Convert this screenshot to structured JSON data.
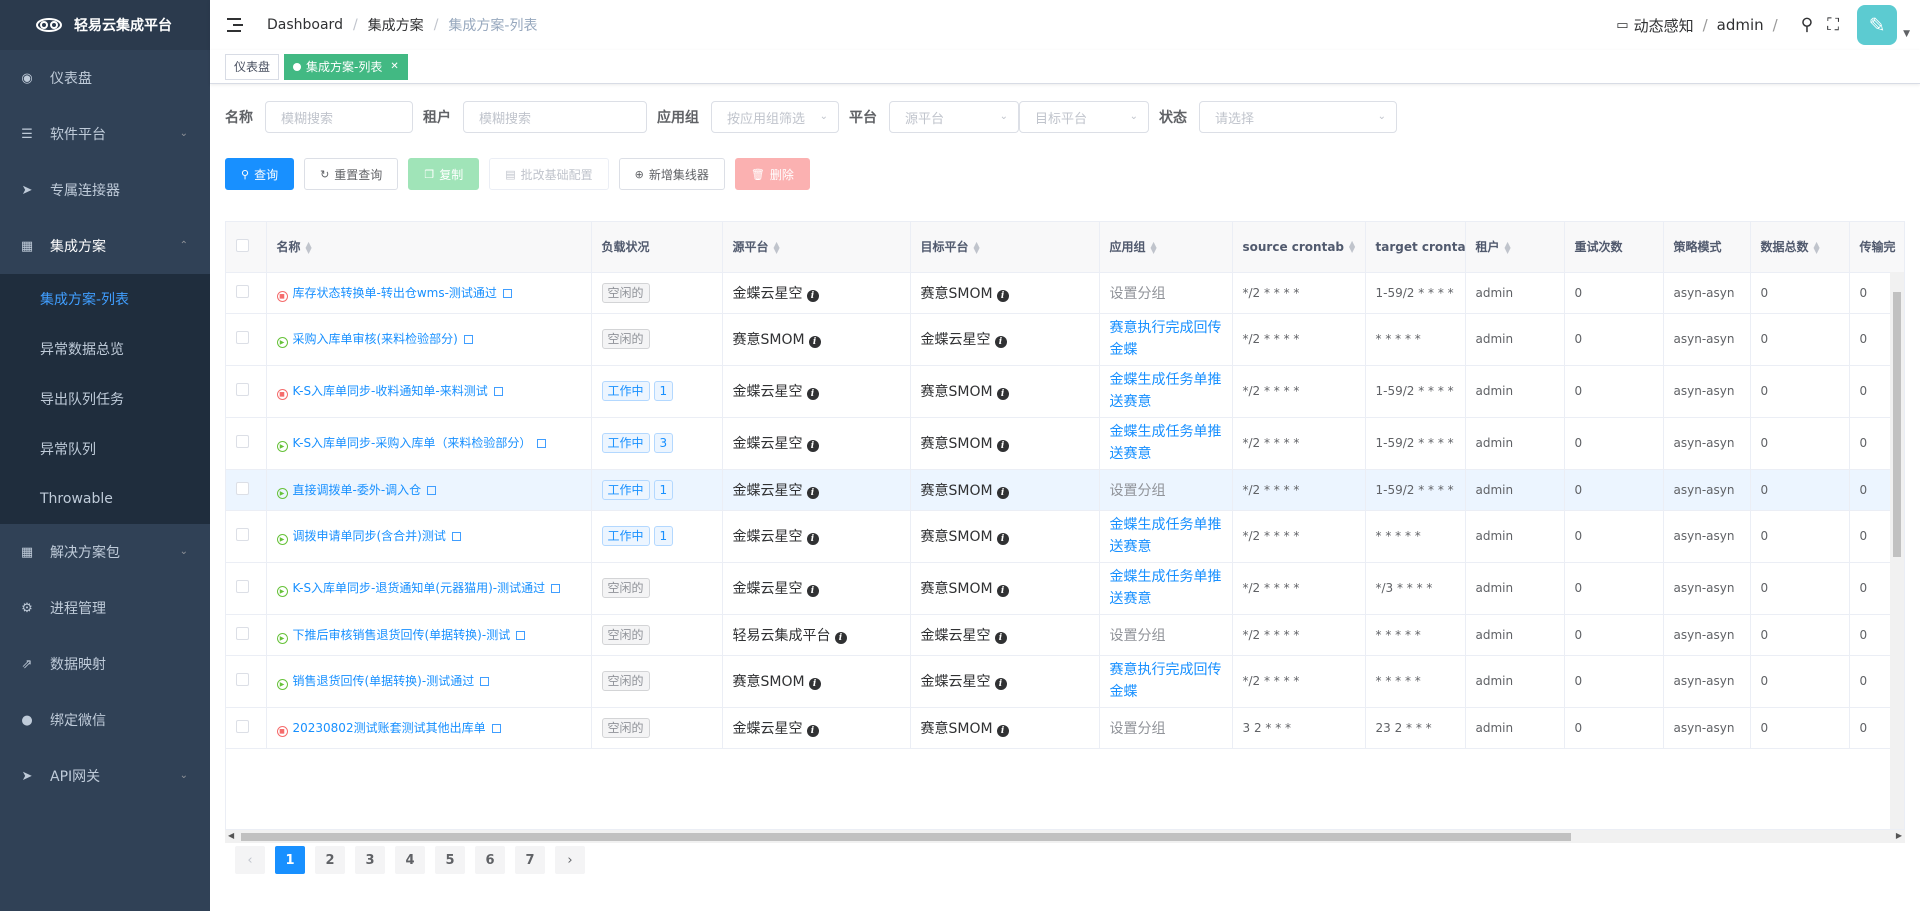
{
  "app": {
    "title": "轻易云集成平台"
  },
  "sidebar": {
    "items": [
      {
        "label": "仪表盘",
        "icon": "dashboard-icon"
      },
      {
        "label": "软件平台",
        "icon": "database-icon"
      },
      {
        "label": "专属连接器",
        "icon": "send-icon"
      },
      {
        "label": "集成方案",
        "icon": "grid-icon"
      },
      {
        "label": "解决方案包",
        "icon": "grid-icon"
      },
      {
        "label": "进程管理",
        "icon": "chip-icon"
      },
      {
        "label": "数据映射",
        "icon": "external-link-icon"
      },
      {
        "label": "绑定微信",
        "icon": "wechat-icon"
      },
      {
        "label": "API网关",
        "icon": "send-icon"
      }
    ],
    "sub_items": [
      "集成方案-列表",
      "异常数据总览",
      "导出队列任务",
      "异常队列",
      "Throwable"
    ]
  },
  "header": {
    "breadcrumb": [
      "Dashboard",
      "集成方案",
      "集成方案-列表"
    ],
    "dynamic": "动态感知",
    "user": "admin"
  },
  "tags": {
    "dashboard": "仪表盘",
    "current": "集成方案-列表"
  },
  "filters": {
    "name_label": "名称",
    "name_placeholder": "模糊搜索",
    "tenant_label": "租户",
    "tenant_placeholder": "模糊搜索",
    "group_label": "应用组",
    "group_placeholder": "按应用组筛选",
    "platform_label": "平台",
    "source_placeholder": "源平台",
    "target_placeholder": "目标平台",
    "status_label": "状态",
    "status_placeholder": "请选择"
  },
  "toolbar": {
    "query": "查询",
    "reset": "重置查询",
    "copy": "复制",
    "batch": "批改基础配置",
    "add": "新增集线器",
    "delete": "删除"
  },
  "table": {
    "columns": [
      "名称",
      "负载状况",
      "源平台",
      "目标平台",
      "应用组",
      "source crontab",
      "target crontab",
      "租户",
      "重试次数",
      "策略模式",
      "数据总数",
      "传输完"
    ],
    "rows": [
      {
        "status": "err",
        "name": "库存状态转换单-转出仓wms-测试通过",
        "load": "空闲的",
        "count": "",
        "src": "金蝶云星空",
        "tgt": "赛意SMOM",
        "group": "设置分组",
        "glink": false,
        "sc": "*/2 * * * *",
        "tc": "1-59/2 * * * *",
        "tenant": "admin",
        "retry": "0",
        "mode": "asyn-asyn",
        "total": "0",
        "trans": "0"
      },
      {
        "status": "ok",
        "name": "采购入库单审核(来料检验部分)",
        "load": "空闲的",
        "count": "",
        "src": "赛意SMOM",
        "tgt": "金蝶云星空",
        "group": "赛意执行完成回传金蝶",
        "glink": true,
        "sc": "*/2 * * * *",
        "tc": "* * * * *",
        "tenant": "admin",
        "retry": "0",
        "mode": "asyn-asyn",
        "total": "0",
        "trans": "0"
      },
      {
        "status": "err",
        "name": "K-S入库单同步-收料通知单-来料测试",
        "load": "工作中",
        "count": "1",
        "src": "金蝶云星空",
        "tgt": "赛意SMOM",
        "group": "金蝶生成任务单推送赛意",
        "glink": true,
        "sc": "*/2 * * * *",
        "tc": "1-59/2 * * * *",
        "tenant": "admin",
        "retry": "0",
        "mode": "asyn-asyn",
        "total": "0",
        "trans": "0"
      },
      {
        "status": "ok",
        "name": "K-S入库单同步-采购入库单（来料检验部分）",
        "load": "工作中",
        "count": "3",
        "src": "金蝶云星空",
        "tgt": "赛意SMOM",
        "group": "金蝶生成任务单推送赛意",
        "glink": true,
        "sc": "*/2 * * * *",
        "tc": "1-59/2 * * * *",
        "tenant": "admin",
        "retry": "0",
        "mode": "asyn-asyn",
        "total": "0",
        "trans": "0"
      },
      {
        "status": "ok",
        "name": "直接调拨单-委外-调入仓",
        "load": "工作中",
        "count": "1",
        "src": "金蝶云星空",
        "tgt": "赛意SMOM",
        "group": "设置分组",
        "glink": false,
        "sc": "*/2 * * * *",
        "tc": "1-59/2 * * * *",
        "tenant": "admin",
        "retry": "0",
        "mode": "asyn-asyn",
        "total": "0",
        "trans": "0"
      },
      {
        "status": "ok",
        "name": "调拨申请单同步(含合并)测试",
        "load": "工作中",
        "count": "1",
        "src": "金蝶云星空",
        "tgt": "赛意SMOM",
        "group": "金蝶生成任务单推送赛意",
        "glink": true,
        "sc": "*/2 * * * *",
        "tc": "* * * * *",
        "tenant": "admin",
        "retry": "0",
        "mode": "asyn-asyn",
        "total": "0",
        "trans": "0"
      },
      {
        "status": "ok",
        "name": "K-S入库单同步-退货通知单(元器猫用)-测试通过",
        "load": "空闲的",
        "count": "",
        "src": "金蝶云星空",
        "tgt": "赛意SMOM",
        "group": "金蝶生成任务单推送赛意",
        "glink": true,
        "sc": "*/2 * * * *",
        "tc": "*/3 * * * *",
        "tenant": "admin",
        "retry": "0",
        "mode": "asyn-asyn",
        "total": "0",
        "trans": "0"
      },
      {
        "status": "ok",
        "name": "下推后审核销售退货回传(单据转换)-测试",
        "load": "空闲的",
        "count": "",
        "src": "轻易云集成平台",
        "tgt": "金蝶云星空",
        "group": "设置分组",
        "glink": false,
        "sc": "*/2 * * * *",
        "tc": "* * * * *",
        "tenant": "admin",
        "retry": "0",
        "mode": "asyn-asyn",
        "total": "0",
        "trans": "0"
      },
      {
        "status": "ok",
        "name": "销售退货回传(单据转换)-测试通过",
        "load": "空闲的",
        "count": "",
        "src": "赛意SMOM",
        "tgt": "金蝶云星空",
        "group": "赛意执行完成回传金蝶",
        "glink": true,
        "sc": "*/2 * * * *",
        "tc": "* * * * *",
        "tenant": "admin",
        "retry": "0",
        "mode": "asyn-asyn",
        "total": "0",
        "trans": "0"
      },
      {
        "status": "err",
        "name": "20230802测试账套测试其他出库单",
        "load": "空闲的",
        "count": "",
        "src": "金蝶云星空",
        "tgt": "赛意SMOM",
        "group": "设置分组",
        "glink": false,
        "sc": "3 2 * * *",
        "tc": "23 2 * * *",
        "tenant": "admin",
        "retry": "0",
        "mode": "asyn-asyn",
        "total": "0",
        "trans": "0"
      }
    ]
  },
  "pagination": {
    "pages": [
      "1",
      "2",
      "3",
      "4",
      "5",
      "6",
      "7"
    ],
    "current": "1"
  },
  "colors": {
    "sidebar": "#304156",
    "accent": "#1890ff",
    "success": "#42b983"
  }
}
